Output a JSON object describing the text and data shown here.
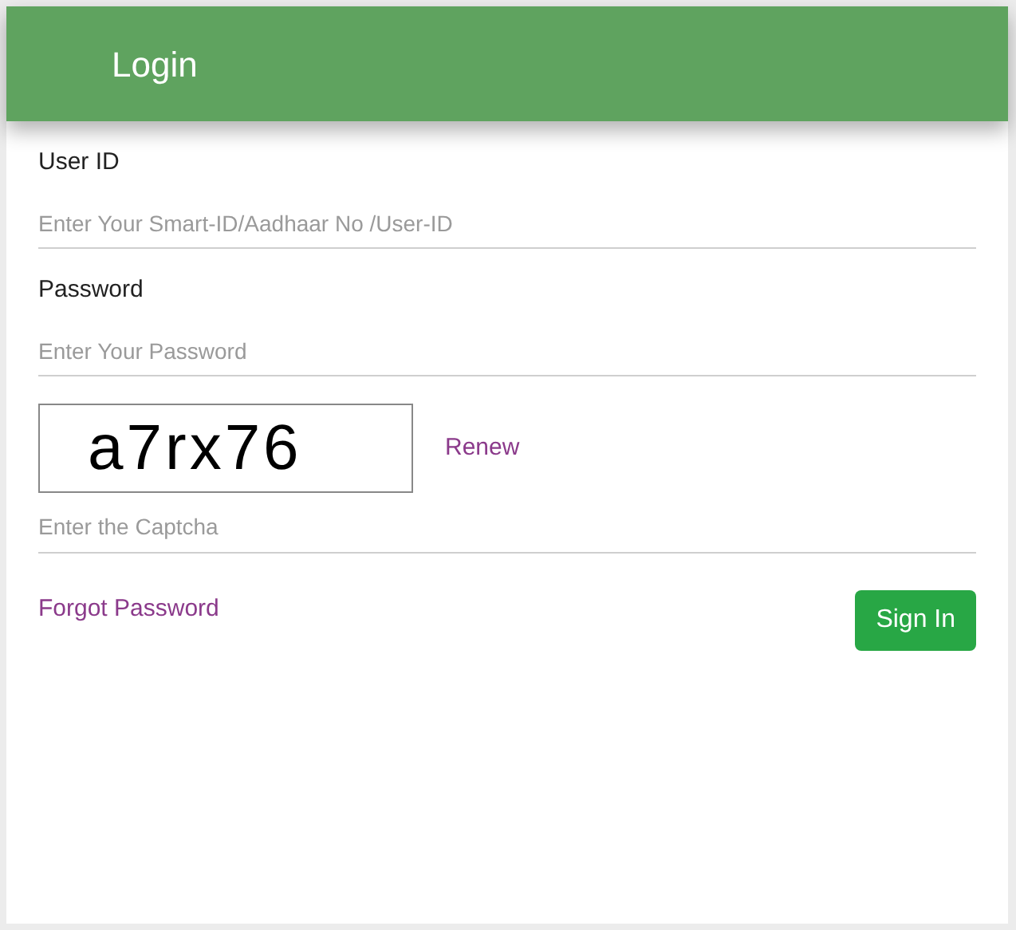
{
  "header": {
    "title": "Login"
  },
  "fields": [
    {
      "label": "User ID",
      "placeholder": "Enter Your Smart-ID/Aadhaar No /User-ID"
    },
    {
      "label": "Password",
      "placeholder": "Enter Your Password"
    }
  ],
  "captcha": {
    "code": "a7rx76",
    "renew": "Renew",
    "placeholder": "Enter the Captcha"
  },
  "forgot_link": "Forgot Password",
  "submit_button": "Sign In"
}
